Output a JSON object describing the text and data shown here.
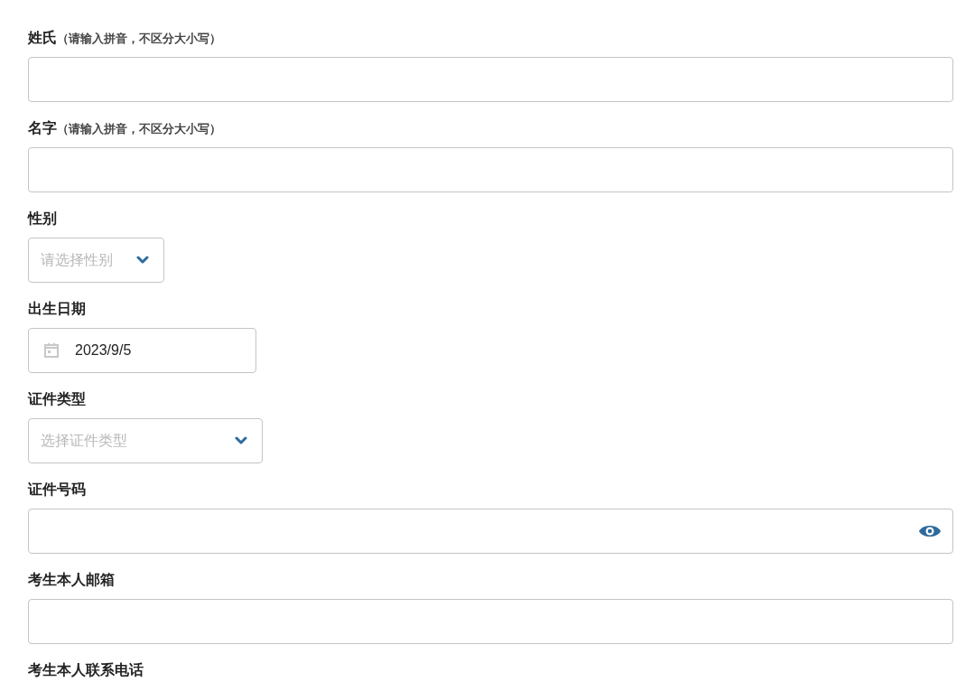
{
  "fields": [
    {
      "label": "姓氏",
      "hint": "（请输入拼音，不区分大小写）",
      "kind": "text"
    },
    {
      "label": "名字",
      "hint": "（请输入拼音，不区分大小写）",
      "kind": "text"
    },
    {
      "label": "性别",
      "kind": "select",
      "placeholder": "请选择性别"
    },
    {
      "label": "出生日期",
      "kind": "date",
      "value": "2023/9/5"
    },
    {
      "label": "证件类型",
      "kind": "select",
      "placeholder": "选择证件类型"
    },
    {
      "label": "证件号码",
      "kind": "secret"
    },
    {
      "label": "考生本人邮箱",
      "kind": "text"
    },
    {
      "label": "考生本人联系电话"
    }
  ]
}
